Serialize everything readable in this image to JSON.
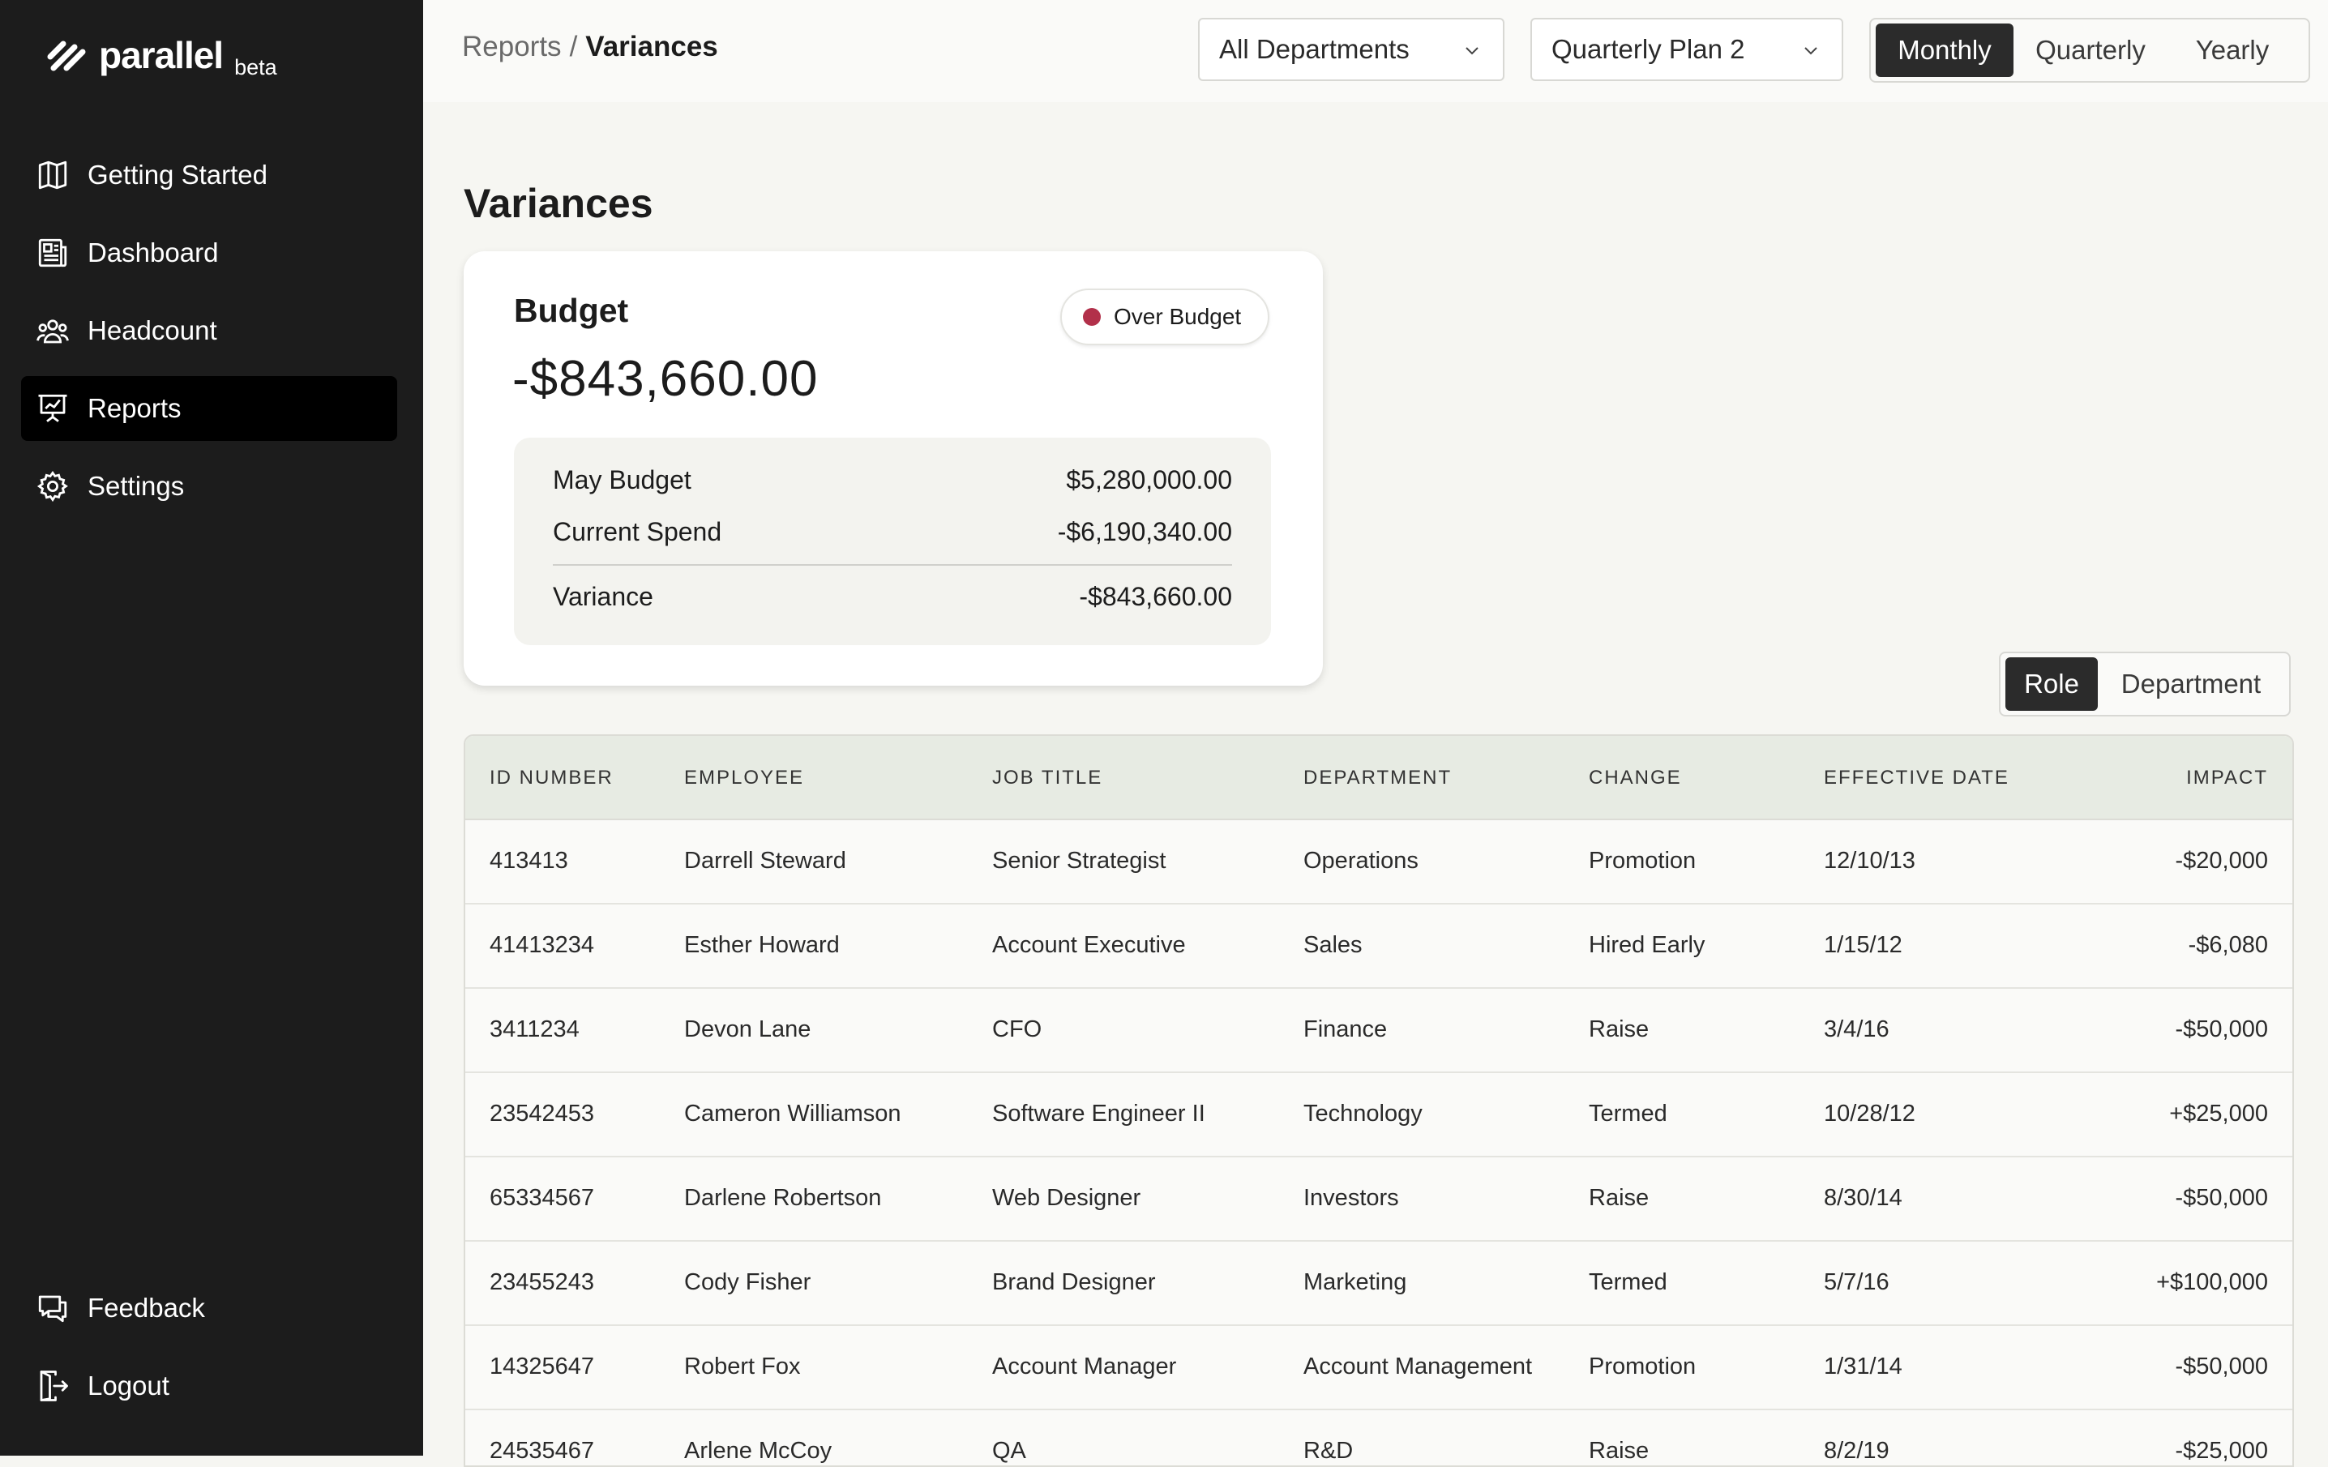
{
  "brand": {
    "name": "parallel",
    "tag": "beta"
  },
  "sidebar": {
    "items": [
      {
        "label": "Getting Started",
        "icon": "map-icon"
      },
      {
        "label": "Dashboard",
        "icon": "newspaper-icon"
      },
      {
        "label": "Headcount",
        "icon": "people-icon"
      },
      {
        "label": "Reports",
        "icon": "presentation-chart-icon",
        "active": true
      },
      {
        "label": "Settings",
        "icon": "gear-icon"
      }
    ],
    "bottom_items": [
      {
        "label": "Feedback",
        "icon": "chat-icon"
      },
      {
        "label": "Logout",
        "icon": "logout-icon"
      }
    ]
  },
  "header": {
    "breadcrumb": {
      "parent": "Reports",
      "separator": "/",
      "current": "Variances"
    },
    "department_select": "All Departments",
    "plan_select": "Quarterly Plan 2",
    "period_toggle": {
      "options": [
        "Monthly",
        "Quarterly",
        "Yearly"
      ],
      "selected": "Monthly"
    }
  },
  "page": {
    "title": "Variances"
  },
  "budget": {
    "heading": "Budget",
    "amount": "-$843,660.00",
    "status": "Over Budget",
    "status_color": "#b2304a",
    "rows": [
      {
        "label": "May Budget",
        "value": "$5,280,000.00"
      },
      {
        "label": "Current Spend",
        "value": "-$6,190,340.00"
      },
      {
        "label": "Variance",
        "value": "-$843,660.00"
      }
    ]
  },
  "view_toggle": {
    "options": [
      "Role",
      "Department"
    ],
    "selected": "Role"
  },
  "table": {
    "columns": [
      "ID NUMBER",
      "EMPLOYEE",
      "JOB TITLE",
      "DEPARTMENT",
      "CHANGE",
      "EFFECTIVE DATE",
      "IMPACT"
    ],
    "rows": [
      [
        "413413",
        "Darrell Steward",
        "Senior Strategist",
        "Operations",
        "Promotion",
        "12/10/13",
        "-$20,000"
      ],
      [
        "41413234",
        "Esther Howard",
        "Account Executive",
        "Sales",
        "Hired Early",
        "1/15/12",
        "-$6,080"
      ],
      [
        "3411234",
        "Devon Lane",
        "CFO",
        "Finance",
        "Raise",
        "3/4/16",
        "-$50,000"
      ],
      [
        "23542453",
        "Cameron Williamson",
        "Software Engineer II",
        "Technology",
        "Termed",
        "10/28/12",
        "+$25,000"
      ],
      [
        "65334567",
        "Darlene Robertson",
        "Web Designer",
        "Investors",
        "Raise",
        "8/30/14",
        "-$50,000"
      ],
      [
        "23455243",
        "Cody Fisher",
        "Brand Designer",
        "Marketing",
        "Termed",
        "5/7/16",
        "+$100,000"
      ],
      [
        "14325647",
        "Robert Fox",
        "Account Manager",
        "Account Management",
        "Promotion",
        "1/31/14",
        "-$50,000"
      ],
      [
        "24535467",
        "Arlene McCoy",
        "QA",
        "R&D",
        "Raise",
        "8/2/19",
        "-$25,000"
      ]
    ]
  }
}
